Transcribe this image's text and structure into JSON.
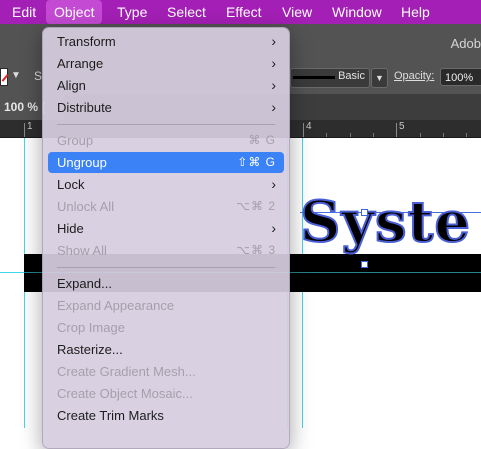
{
  "menubar": {
    "items": [
      "Edit",
      "Object",
      "Type",
      "Select",
      "Effect",
      "View",
      "Window",
      "Help"
    ],
    "active_index": 1
  },
  "control_bar": {
    "brand": "Adob",
    "s_label": "S",
    "stroke_profile": "Basic",
    "opacity_label": "Opacity:",
    "opacity_value": "100%"
  },
  "document_tab": {
    "label": "100 % ("
  },
  "ruler": {
    "labels": [
      "1",
      "4",
      "5"
    ]
  },
  "artwork": {
    "text": "Syste"
  },
  "object_menu": {
    "items": [
      {
        "label": "Transform",
        "submenu": true,
        "enabled": true
      },
      {
        "label": "Arrange",
        "submenu": true,
        "enabled": true
      },
      {
        "label": "Align",
        "submenu": true,
        "enabled": true
      },
      {
        "label": "Distribute",
        "submenu": true,
        "enabled": true
      },
      {
        "label": "Group",
        "shortcut": "⌘ G",
        "enabled": false
      },
      {
        "label": "Ungroup",
        "shortcut": "⇧⌘ G",
        "enabled": true,
        "highlighted": true
      },
      {
        "label": "Lock",
        "submenu": true,
        "enabled": true
      },
      {
        "label": "Unlock All",
        "shortcut": "⌥⌘ 2",
        "enabled": false
      },
      {
        "label": "Hide",
        "submenu": true,
        "enabled": true
      },
      {
        "label": "Show All",
        "shortcut": "⌥⌘ 3",
        "enabled": false
      },
      {
        "label": "Expand...",
        "enabled": true
      },
      {
        "label": "Expand Appearance",
        "enabled": false
      },
      {
        "label": "Crop Image",
        "enabled": false
      },
      {
        "label": "Rasterize...",
        "enabled": true
      },
      {
        "label": "Create Gradient Mesh...",
        "enabled": false
      },
      {
        "label": "Create Object Mosaic...",
        "enabled": false
      },
      {
        "label": "Create Trim Marks",
        "enabled": true
      }
    ]
  },
  "colors": {
    "menubar_bg": "#a31fb5",
    "highlight": "#3b82f6",
    "guide": "#3fd8e8"
  }
}
